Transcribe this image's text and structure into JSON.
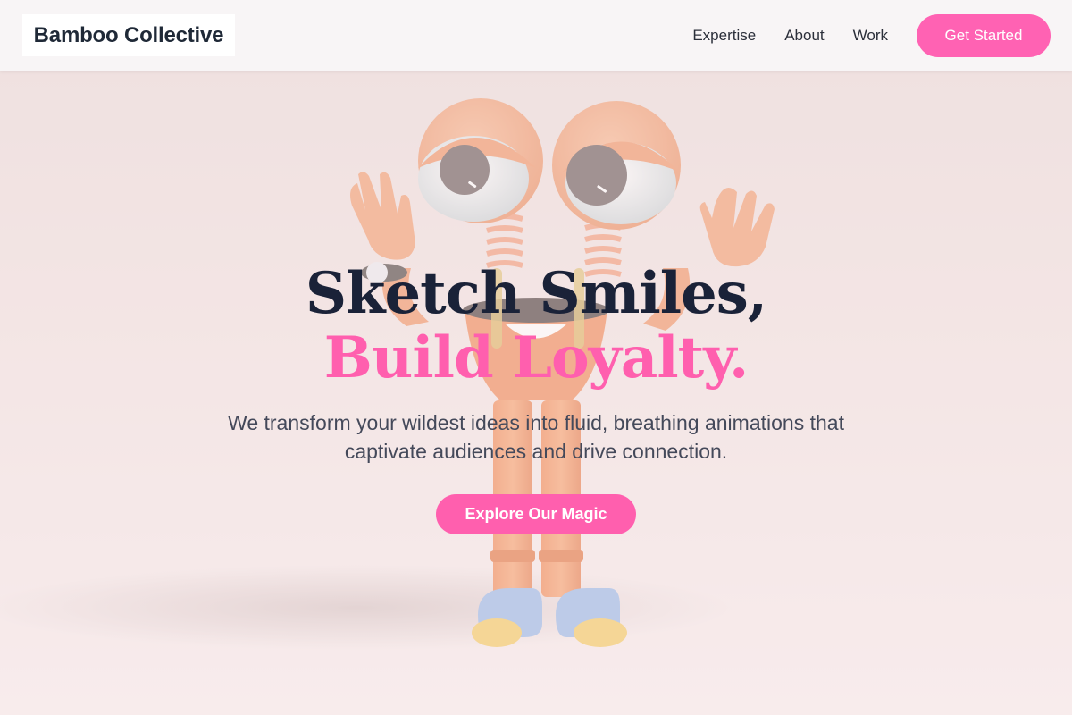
{
  "header": {
    "brand": "Bamboo Collective",
    "nav": [
      "Expertise",
      "About",
      "Work"
    ],
    "cta_label": "Get Started"
  },
  "hero": {
    "headline_line1": "Sketch Smiles,",
    "headline_line2": "Build Loyalty.",
    "subtext": "We transform your wildest ideas into fluid, breathing animations that captivate audiences and drive connection.",
    "button_label": "Explore Our Magic",
    "illustration": "cartoon-character-illustration"
  },
  "colors": {
    "accent_pink": "#ff62b3",
    "headline_dark": "#1a2238",
    "text_gray": "#44495a",
    "header_bg": "#f8f5f6"
  }
}
